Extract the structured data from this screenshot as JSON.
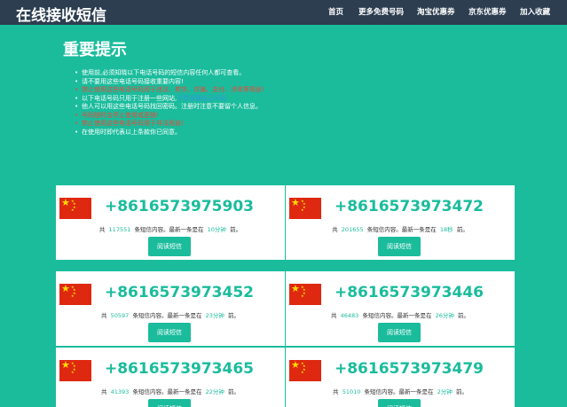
{
  "navbar": {
    "brand": "在线接收短信",
    "items": [
      "首页",
      "更多免费号码",
      "淘宝优惠券",
      "京东优惠券",
      "加入收藏"
    ]
  },
  "notice": {
    "title": "重要提示",
    "items": [
      {
        "text": "使用前,必须知晓以下电话号码的短信内容任何人都可查看。",
        "style": "normal"
      },
      {
        "text": "请不要用这些电话号码接收重要内容!",
        "style": "normal"
      },
      {
        "text": "禁止使用这些电话号码用于违法、欺诈、诈骗、支付、涉政等用途!",
        "style": "red"
      },
      {
        "text": "以下电话号码只用于注册一些网站,",
        "link": "不想泄露自己号码",
        "style": "normal"
      },
      {
        "text": "他人可以用这些电话号码找回密码。注册时注意不要留个人信息。",
        "style": "normal"
      },
      {
        "text": "号码随时会停止使用或更换!",
        "style": "red"
      },
      {
        "text": "禁止使用这些电话号码用于非法用途!",
        "style": "red"
      },
      {
        "text": "在使用时即代表以上条款你已同意。",
        "style": "normal"
      }
    ]
  },
  "cards": [
    {
      "number": "+8616573975903",
      "count": "117551",
      "time": "10分钟"
    },
    {
      "number": "+8616573973472",
      "count": "201655",
      "time": "18秒"
    },
    {
      "number": "+8616573973452",
      "count": "50597",
      "time": "23分钟"
    },
    {
      "number": "+8616573973446",
      "count": "46483",
      "time": "26分钟"
    },
    {
      "number": "+8616573973465",
      "count": "41393",
      "time": "22分钟"
    },
    {
      "number": "+8616573973479",
      "count": "51010",
      "time": "2分钟"
    }
  ],
  "card_text": {
    "prefix": "共",
    "mid": "条短信内容。最新一条是在",
    "suffix": "前。",
    "button": "阅读短信"
  },
  "colors": {
    "background": "#1abc9c",
    "navbar": "#2c3e50",
    "accent": "#1abc9c",
    "warning": "#e74c3c"
  }
}
